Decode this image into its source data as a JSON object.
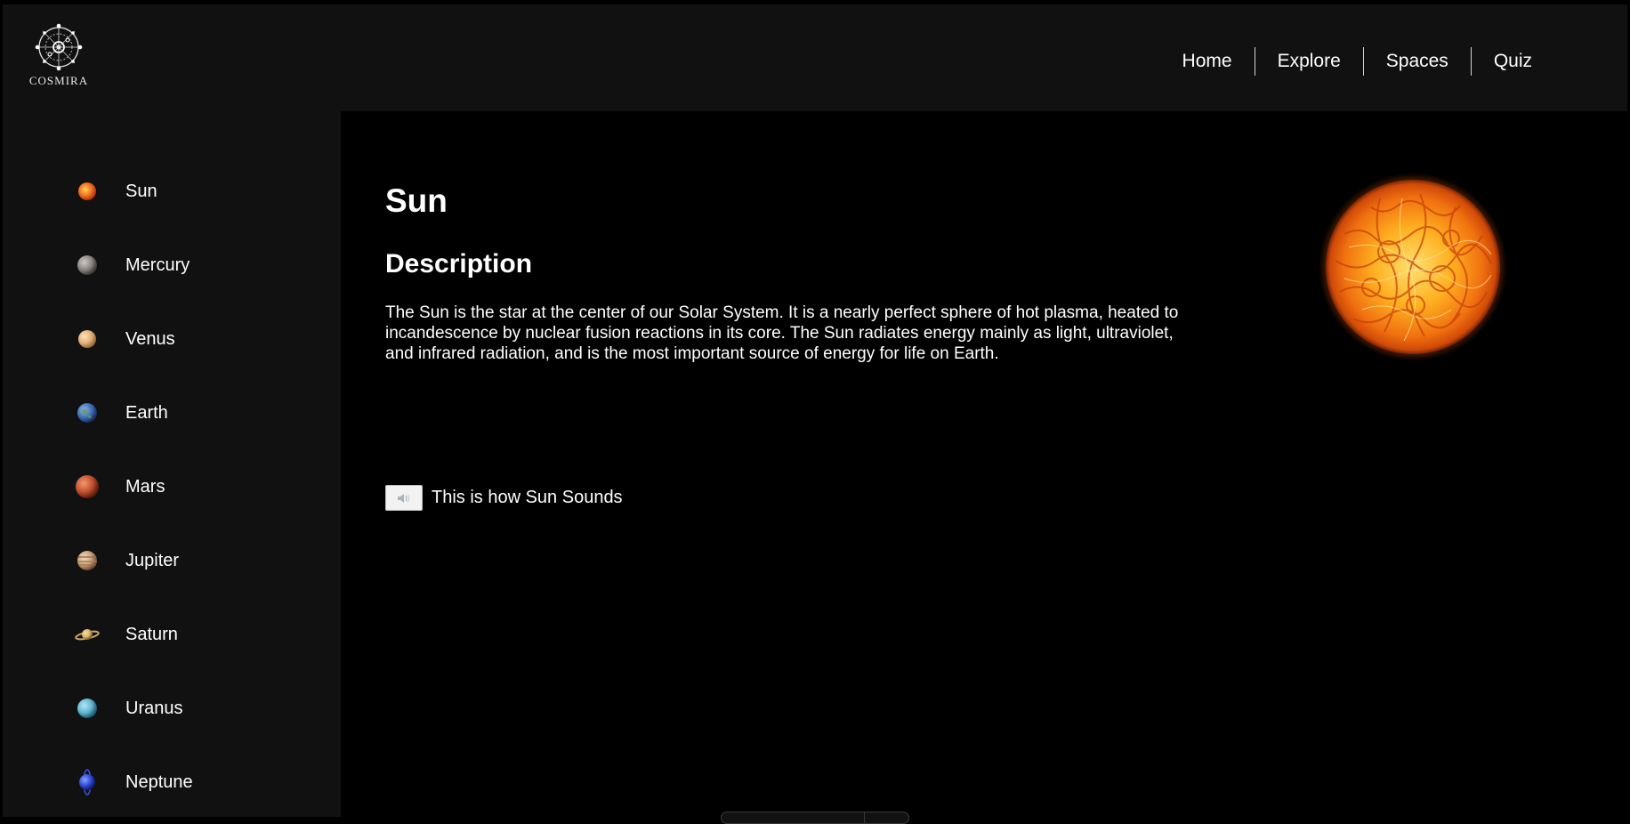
{
  "header": {
    "logo_text": "COSMIRA",
    "nav": [
      {
        "label": "Home"
      },
      {
        "label": "Explore"
      },
      {
        "label": "Spaces"
      },
      {
        "label": "Quiz"
      }
    ]
  },
  "sidebar": {
    "items": [
      {
        "label": "Sun",
        "icon": "sun-icon",
        "color": "#e8501a"
      },
      {
        "label": "Mercury",
        "icon": "mercury-icon",
        "color": "#8a8580"
      },
      {
        "label": "Venus",
        "icon": "venus-icon",
        "color": "#e3b07a"
      },
      {
        "label": "Earth",
        "icon": "earth-icon",
        "color": "#3f6fb8"
      },
      {
        "label": "Mars",
        "icon": "mars-icon",
        "color": "#c1502c"
      },
      {
        "label": "Jupiter",
        "icon": "jupiter-icon",
        "color": "#c9a17a"
      },
      {
        "label": "Saturn",
        "icon": "saturn-icon",
        "color": "#d8b36a"
      },
      {
        "label": "Uranus",
        "icon": "uranus-icon",
        "color": "#5fb6d1"
      },
      {
        "label": "Neptune",
        "icon": "neptune-icon",
        "color": "#2f49d6"
      }
    ]
  },
  "main": {
    "title": "Sun",
    "subtitle": "Description",
    "description": "The Sun is the star at the center of our Solar System. It is a nearly perfect sphere of hot plasma, heated to incandescence by nuclear fusion reactions in its core. The Sun radiates energy mainly as light, ultraviolet, and infrared radiation, and is the most important source of energy for life on Earth.",
    "sound_label": "This is how Sun Sounds",
    "sound_icon": "speaker-icon",
    "image_icon": "sun-image"
  },
  "colors": {
    "background": "#000000",
    "panel": "#121112",
    "text": "#ffffff"
  }
}
